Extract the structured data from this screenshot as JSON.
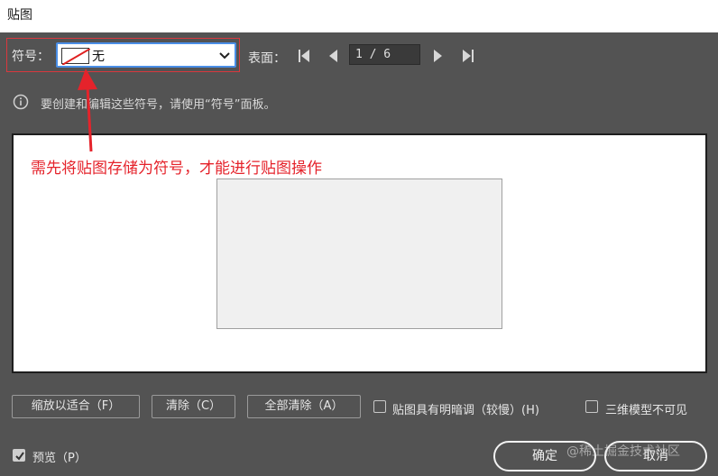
{
  "window": {
    "title": "贴图"
  },
  "symbol": {
    "label": "符号：",
    "selected": "无"
  },
  "surface": {
    "label": "表面：",
    "page": "1 / 6"
  },
  "info": {
    "text": "要创建和编辑这些符号，请使用“符号”面板。"
  },
  "annotation": {
    "text": "需先将贴图存储为符号，才能进行贴图操作",
    "color": "#e5232b"
  },
  "buttons": {
    "fit": "缩放以适合（F）",
    "clear": "清除（C）",
    "clear_all": "全部清除（A）",
    "ok": "确定",
    "cancel": "取消"
  },
  "options": {
    "shade": {
      "label": "贴图具有明暗调（较慢）(H)",
      "checked": false
    },
    "invisible": {
      "label": "三维模型不可见",
      "checked": false
    },
    "preview": {
      "label": "预览（P）",
      "checked": true
    }
  },
  "watermark": "@稀土掘金技术社区",
  "colors": {
    "accent": "#4a8ee6",
    "highlight": "#d9383e"
  }
}
